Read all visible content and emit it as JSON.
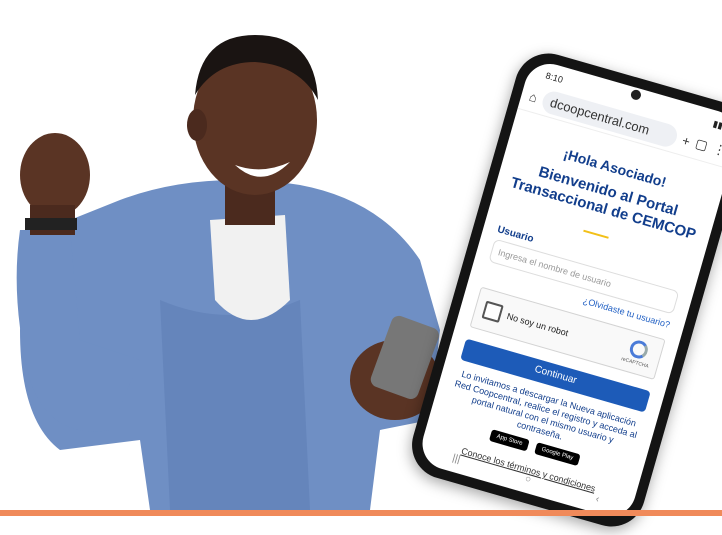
{
  "colors": {
    "brand": "#123e8c",
    "button": "#1d5bb8",
    "accent_bar": "#f08a5a"
  },
  "phone": {
    "status_time": "8:10",
    "url": "dcoopcentral.com",
    "greeting": "¡Hola Asociado!",
    "welcome_line1": "Bienvenido al Portal",
    "welcome_line2": "Transaccional de CEMCOP",
    "user_label": "Usuario",
    "user_placeholder": "Ingresa el nombre de usuario",
    "forgot_link": "¿Olvidaste tu usuario?",
    "captcha_label": "No soy un robot",
    "captcha_brand": "reCAPTCHA",
    "continue_button": "Continuar",
    "invite_text": "Lo invitamos a descargar la Nueva aplicación Red Coopcentral, realice el registro y acceda al portal natural con el mismo usuario y contraseña.",
    "app_store": "App Store",
    "google_play": "Google Play",
    "terms_link": "Conoce los términos y condiciones"
  }
}
